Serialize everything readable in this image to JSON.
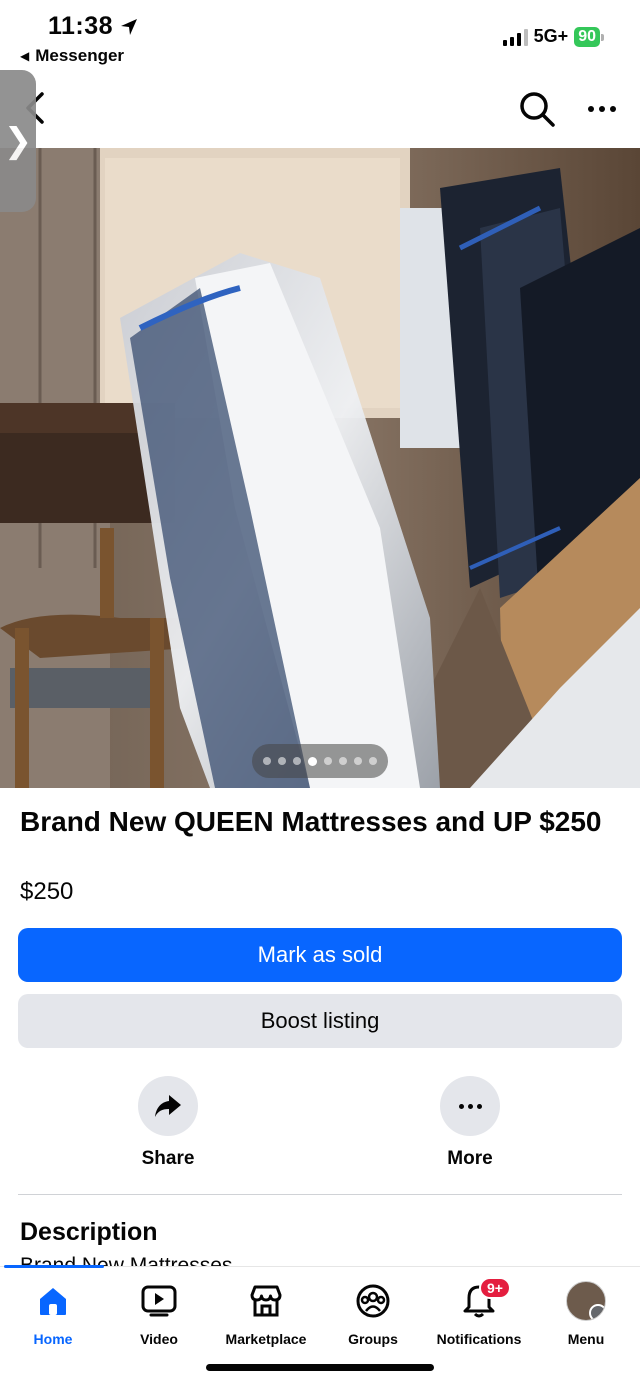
{
  "status_bar": {
    "time": "11:38",
    "back_app": "Messenger",
    "network": "5G+",
    "battery": "90"
  },
  "icons": {
    "location": "location-arrow-icon",
    "back": "chevron-left-icon",
    "search": "search-icon",
    "more": "more-icon",
    "share": "share-icon",
    "home": "home-icon",
    "video": "video-icon",
    "marketplace": "marketplace-icon",
    "groups": "groups-icon",
    "notifications": "bell-icon"
  },
  "photo": {
    "total_slides": 8,
    "active_slide": 4
  },
  "listing": {
    "title": "Brand New QUEEN Mattresses and UP $250",
    "price": "$250",
    "mark_sold_label": "Mark as sold",
    "boost_label": "Boost listing"
  },
  "actions": {
    "share_label": "Share",
    "more_label": "More"
  },
  "description": {
    "heading": "Description",
    "text": "Brand New Mattresses"
  },
  "bottom_nav": {
    "items": [
      {
        "label": "Home",
        "active": true
      },
      {
        "label": "Video"
      },
      {
        "label": "Marketplace"
      },
      {
        "label": "Groups"
      },
      {
        "label": "Notifications",
        "badge": "9+"
      },
      {
        "label": "Menu"
      }
    ]
  },
  "colors": {
    "primary": "#0866ff",
    "secondary_button": "#e4e6eb",
    "badge": "#e41e3f",
    "battery": "#34c759"
  }
}
